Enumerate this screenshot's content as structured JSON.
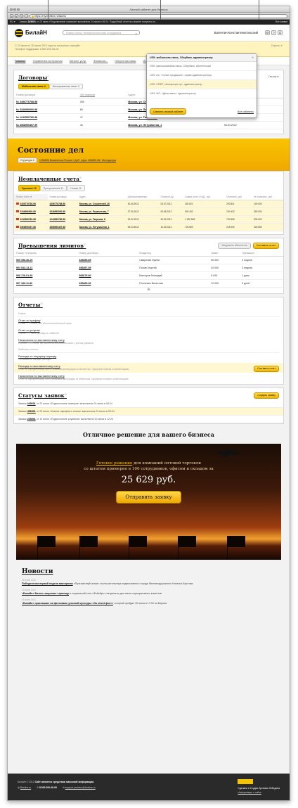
{
  "window": {
    "title": "Личный кабинет для бизнеса",
    "url": "https://my.beeline.ru/faces/"
  },
  "blackbar": {
    "lang": "RU ▾",
    "message_pre": "Заявка",
    "message_num": "245691",
    "message_text": "от 23 июля «Подключение номеров» выполнена 24 июля в 05:24. Подробный отчет вы можете получить по...",
    "all_label": "Все заявки"
  },
  "header": {
    "logo": "БилайН",
    "search_placeholder": "Номер счета, телефона или имя сотрудника",
    "user": "Валентин Константинопольский"
  },
  "notice": {
    "line1": "С 23 июля по 30 июля 2012 года на несколько станций»",
    "line2": "Телефон поддержки: 8 800 200-06-00",
    "close": "Скрыть ✕"
  },
  "menu": [
    "Главное",
    "Управление контрактом",
    "Каталог услуг",
    "Финансов...",
    "Оборотная связь",
    "История запросов"
  ],
  "dropdown": {
    "header": "USS: мобильная связь, Сбербанк, администратор",
    "items": [
      "USS: фиксированная связь, Сбербанк, абонентский",
      "USS: AC, «Сезон продакшн», права администратора",
      "USS: CRBT, «Альфа-центр», администратор",
      "USS: MC, «Дельтавит», администратор"
    ],
    "change_btn": "Сменить личный кабинет",
    "all_link": "Все кабинеты"
  },
  "contracts": {
    "title": "Договоры",
    "count": "4",
    "collapse": "Свернуть",
    "tabs": [
      "Мобильная связь 4",
      "Фиксированная связь 3"
    ],
    "headers": [
      "Номер договора",
      "450 номеров",
      "Адрес",
      "Дата заключения"
    ],
    "rows": [
      [
        "№ 3456776788-98",
        "300",
        "Москва, ул. Строителей, 26",
        "30.06.2012"
      ],
      [
        "№ 3346990900-98",
        "60",
        "Москва, ул. Лермонтова, 7",
        "27.05.2012"
      ],
      [
        "№ 1243590780-98",
        "47",
        "Москва, ул. Тверская, 8",
        "23.02.2012"
      ],
      [
        "№ 4568990457-99",
        "43",
        "Москва, ул. Энтузиастов, 1",
        "05.03.2012"
      ]
    ]
  },
  "state": {
    "title": "Состояние дел",
    "crumb_pill": "Структура ▾",
    "crumb_text": "1256896 Вымпелком России / ДоП. офис 456889-98 / Менеджеры"
  },
  "bills": {
    "title": "Неоплаченные счета",
    "count": "30",
    "tabs": [
      "Срочные 12",
      "Просроченные 11",
      "Новые 11"
    ],
    "headers": [
      "Номер счета ▼",
      "Номер договора",
      "Адрес",
      "Дата выставления",
      "Оплатить до",
      "Сумма счета с НДС, руб",
      "Оплачено, руб",
      "Не оплачено, руб"
    ],
    "rows": [
      [
        "3456776788-98",
        "3456776788-98",
        "Москва, ул. Строителей, 26",
        "30.06.2012",
        "03.07.2012",
        "300 821",
        "200 821",
        "100 000"
      ],
      [
        "3346990900-98",
        "3346990900-98",
        "Москва, ул. Лермонтова, 7",
        "27.05.2012",
        "05.06.2012",
        "500 432",
        "150 432",
        "350 000"
      ],
      [
        "1243590780-98",
        "1243590780-98",
        "Москва, ул. Тверская, 8",
        "23.02.2012",
        "30.02.2012",
        "1 230 569",
        "700 569",
        "530 000"
      ],
      [
        "4568990457-98",
        "4568990457-98",
        "Москва, ул. Энтузиастов, 1",
        "05.03.2012",
        "10.03.2012",
        "725 659",
        "225 000",
        "500 659"
      ]
    ]
  },
  "limits": {
    "title": "Превышения лимитов",
    "count": "27",
    "notify_btn": "Уведомить абонентов",
    "report_btn": "Составить отчет",
    "headers": [
      "Номер телефона",
      "Номер договора",
      "Владелец",
      "Лимит",
      "Превышен"
    ],
    "rows": [
      [
        "909 356-36-29",
        "328689-89",
        "Смирнова Ирина",
        "50 000",
        "2 недели"
      ],
      [
        "904 533-13-21",
        "356897-59",
        "Попов Георгий",
        "20 000",
        "3 недели"
      ],
      [
        "908 728-01-60",
        "568675-80",
        "Викторов Геннадий",
        "5 000",
        "1 день"
      ],
      [
        "907 180-11-80",
        "456865-36",
        "Поплевин Вячеслав",
        "12 000",
        "5 дней"
      ]
    ]
  },
  "reports": {
    "title": "Отчеты",
    "count": "20",
    "section_new": "Новые",
    "section_templates": "Шаблоны отчетов",
    "new": [
      {
        "name": "Отчет по трафику",
        "desc": "23 мая — 23 июня, все абоненты мобильной связи"
      },
      {
        "name": "Отчет по услугам",
        "desc": "1 июня — 1 июля, договор № 45689-89"
      },
      {
        "name": "Начисления по выставленному счету",
        "desc": "25 июня — 12 июля, все абоненты мобильной связи, с учетом роуминга"
      }
    ],
    "templates": [
      {
        "name": "Расходы по текущему периоду",
        "desc": "Учитываются текущие расходы"
      },
      {
        "name": "Расходы по выставленному счету",
        "desc": "Отчет по определенному счету. Возможна фильтрация по абонентам, тарифным планам и компенсациям"
      },
      {
        "name": "Начисления по выставленному счету",
        "desc": "Отчет по определенному счету, возможна фильтрация по абонентам, тарифным планам и компенсациям"
      }
    ],
    "make_btn": "Составить отчет"
  },
  "requests": {
    "title": "Статусы заявок",
    "count": "10",
    "create_btn": "Создать заявку",
    "rows": [
      {
        "pre": "Заявка",
        "num": "245691",
        "text": "от 23 июля «Подключение номеров» выполнена 24 июля в 05:24"
      },
      {
        "pre": "Заявка",
        "num": "456891",
        "text": "от 23 июля «Смена тарифного плана» выполнена 24 июля в 05:24"
      },
      {
        "pre": "Заявка",
        "num": "235891",
        "text": "от 19 июля «Подключение роуминга» выполнена 20 июля в 12:24"
      }
    ]
  },
  "promo": {
    "heading": "Отличное решение для вашего бизнеса",
    "line1_u": "Готовое решение",
    "line1": "для компаний оптовой торговли",
    "line2": "со штатом примерно в 100 сотрудников, офисом и складом за",
    "price": "25 629 руб.",
    "button": "Отправить заявку"
  },
  "news": {
    "title": "Новости",
    "items": [
      {
        "date": "26 июня 2012",
        "link": "Победителем первой недели викторины",
        "text": "«Путешествуй читая» стала жительница подмосковного города Железнодорожного Наталья Шустова"
      },
      {
        "date": "19 июня 2012",
        "link": "«Билайн» Бизнес запускает страницу",
        "text": "в социальной сети «Фейсбук» специально для своих корпоративных клиентов"
      },
      {
        "date": "15 июня 2012",
        "link": "«Билайн» приглашает на фестиваль уличной культуры «Go street фест»",
        "text": ", который пройдет 30 июня в 17:00 на Бирюзе"
      }
    ]
  },
  "footer": {
    "copy": "Билайн © 2012",
    "reg": "Сайт является средством массовой информации.",
    "site": "Beeline.ru",
    "phone": "8 800 200-06-00",
    "email": "support.partners@beeline.ru",
    "made": "Сделано в Студии Артемия Лебедева",
    "info": "Информация о сайте"
  }
}
